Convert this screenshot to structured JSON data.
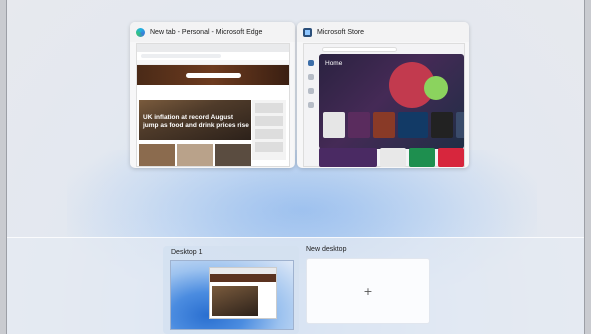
{
  "windows": [
    {
      "title": "New tab - Personal - Microsoft Edge",
      "icon": "edge-icon"
    },
    {
      "title": "Microsoft Store",
      "icon": "microsoft-store-icon"
    }
  ],
  "edge_preview": {
    "headline": "UK inflation at record August jump as food and drink prices rise"
  },
  "store_preview": {
    "page_title": "Home"
  },
  "desktops": {
    "items": [
      {
        "label": "Desktop 1",
        "active": true
      }
    ],
    "new_desktop_label": "New desktop",
    "new_desktop_symbol": "+"
  },
  "colors": {
    "accent": "#2f67c9"
  }
}
